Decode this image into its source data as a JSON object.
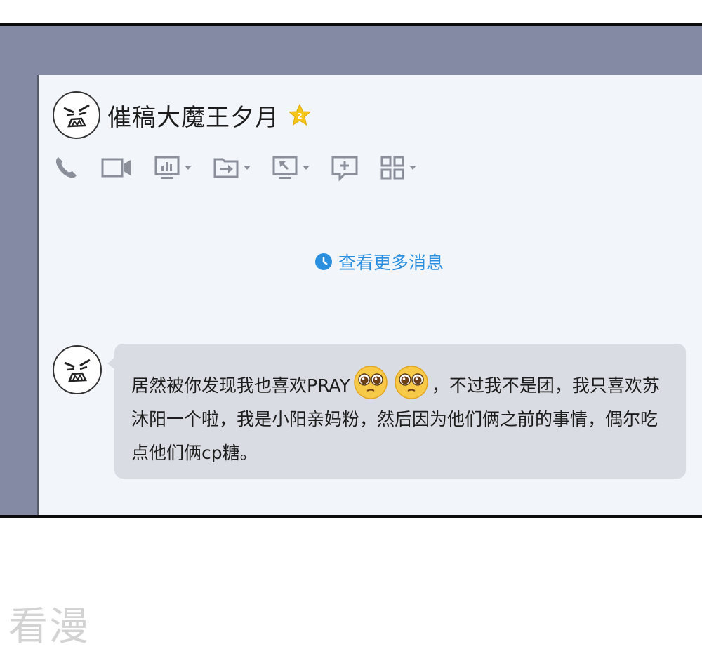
{
  "chat": {
    "contact_name": "催稿大魔王夕月",
    "vip_badge": "star-badge-icon"
  },
  "toolbar": {
    "items": [
      {
        "icon": "phone-icon"
      },
      {
        "icon": "video-camera-icon"
      },
      {
        "icon": "screen-share-icon"
      },
      {
        "icon": "file-transfer-icon"
      },
      {
        "icon": "remote-desktop-icon"
      },
      {
        "icon": "new-message-icon"
      },
      {
        "icon": "apps-grid-icon"
      }
    ]
  },
  "history": {
    "label": "查看更多消息"
  },
  "message": {
    "text_part1": "居然被你发现我也喜欢PRAY",
    "text_part2": "，不过我不是团，我只喜欢苏沐阳一个啦，我是小阳亲妈粉，然后因为他们俩之前的事情，偶尔吃点他们俩cp糖。",
    "emoji_count": 2
  },
  "watermark": {
    "text": "看漫"
  },
  "colors": {
    "frame_bg": "#8489a4",
    "window_bg": "#f2f5fa",
    "bubble_bg": "#d9dde3",
    "link": "#2a8fde",
    "icon": "#8a8f9a"
  }
}
